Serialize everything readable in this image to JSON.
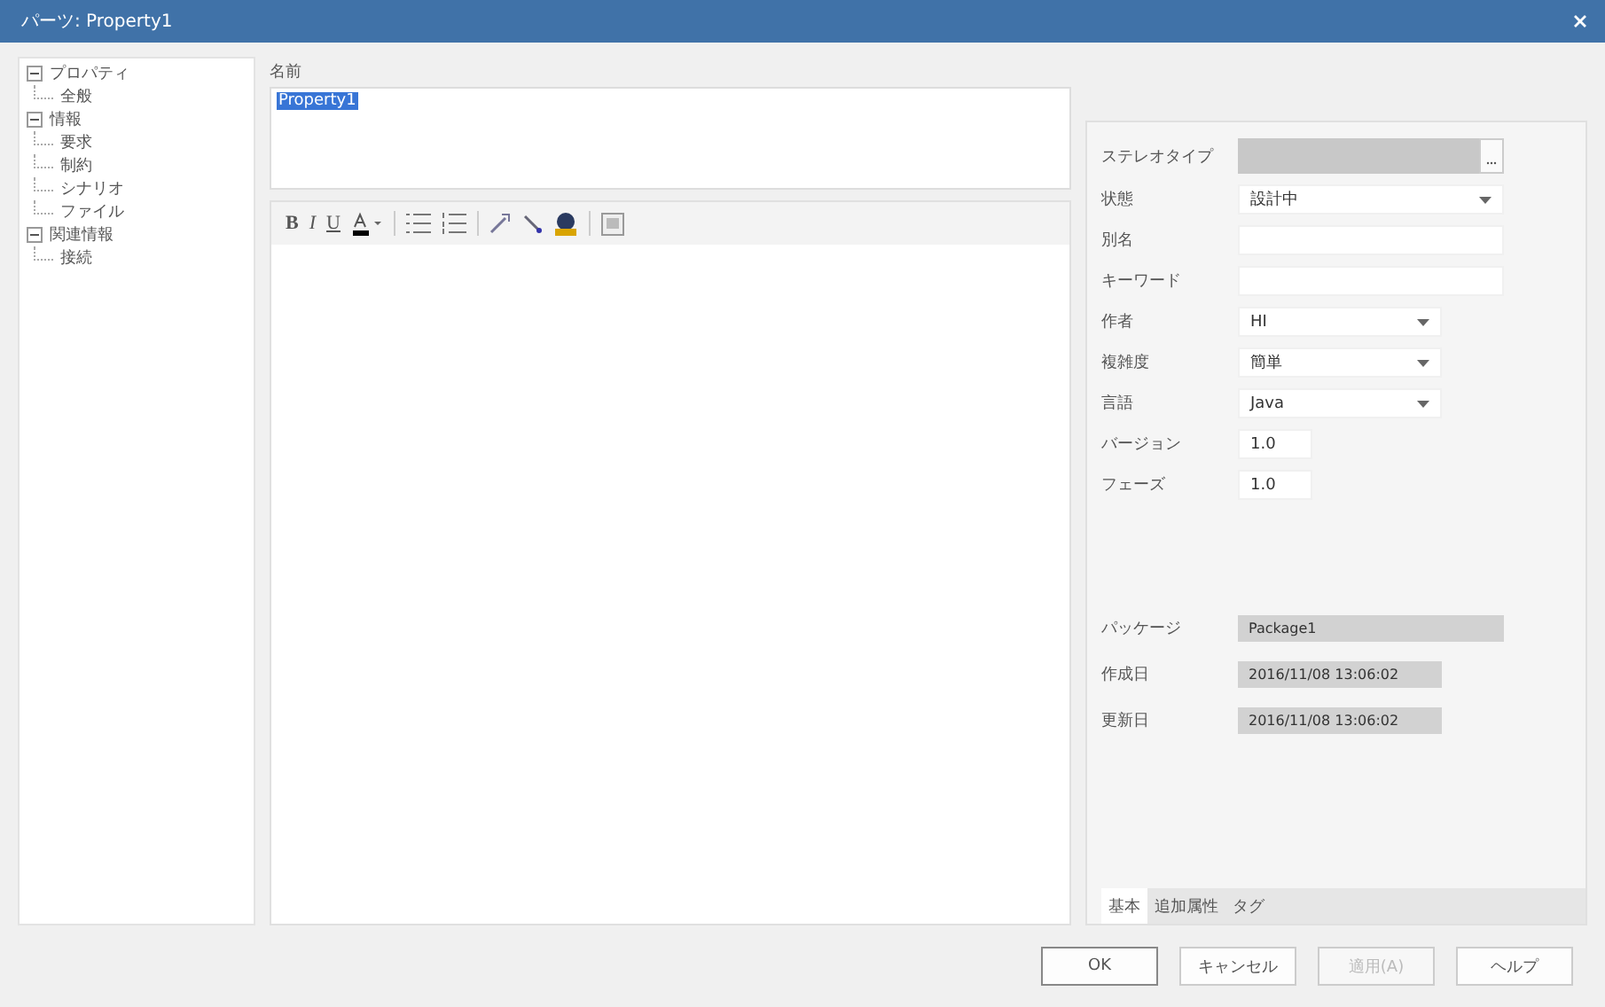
{
  "window": {
    "title": "パーツ: Property1"
  },
  "tree": [
    {
      "label": "プロパティ",
      "expanded": true,
      "children": [
        {
          "label": "全般"
        }
      ]
    },
    {
      "label": "情報",
      "expanded": true,
      "children": [
        {
          "label": "要求"
        },
        {
          "label": "制約"
        },
        {
          "label": "シナリオ"
        },
        {
          "label": "ファイル"
        }
      ]
    },
    {
      "label": "関連情報",
      "expanded": true,
      "children": [
        {
          "label": "接続"
        }
      ]
    }
  ],
  "name_field": {
    "label": "名前",
    "value": "Property1"
  },
  "format_buttons": [
    "B",
    "I",
    "U"
  ],
  "fields": [
    {
      "label": "ステレオタイプ",
      "kind": "stereotype"
    },
    {
      "label": "状態",
      "kind": "combo-wide",
      "value": "設計中"
    },
    {
      "label": "別名",
      "kind": "text-wide"
    },
    {
      "label": "キーワード",
      "kind": "text-wide"
    },
    {
      "label": "作者",
      "kind": "combo",
      "value": "HI"
    },
    {
      "label": "複雑度",
      "kind": "combo",
      "value": "簡単"
    },
    {
      "label": "言語",
      "kind": "combo",
      "value": "Java"
    },
    {
      "label": "バージョン",
      "kind": "text-short",
      "value": "1.0"
    },
    {
      "label": "フェーズ",
      "kind": "text-short",
      "value": "1.0"
    }
  ],
  "info_fields": [
    {
      "label": "パッケージ",
      "kind": "readonly-wide",
      "value": "Package1"
    },
    {
      "label": "作成日",
      "kind": "readonly",
      "value": "2016/11/08 13:06:02"
    },
    {
      "label": "更新日",
      "kind": "readonly",
      "value": "2016/11/08 13:06:02"
    }
  ],
  "tabs": [
    {
      "label": "基本",
      "selected": true
    },
    {
      "label": "追加属性",
      "selected": false
    },
    {
      "label": "タグ",
      "selected": false
    }
  ],
  "buttons": [
    {
      "label": "OK",
      "disabled": false
    },
    {
      "label": "キャンセル",
      "disabled": false
    },
    {
      "label": "適用(A)",
      "disabled": true
    },
    {
      "label": "ヘルプ",
      "disabled": false
    }
  ]
}
